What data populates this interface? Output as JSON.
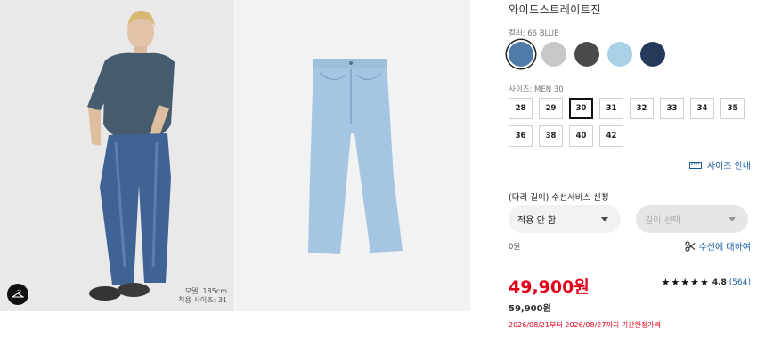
{
  "product": {
    "title": "와이드스트레이트진",
    "color_label": "컬러: 66 BLUE",
    "colors": [
      {
        "name": "blue",
        "hex": "#4e7ba8",
        "selected": true
      },
      {
        "name": "light-gray",
        "hex": "#c6c8c6"
      },
      {
        "name": "dark-gray",
        "hex": "#4a4a4a"
      },
      {
        "name": "light-blue",
        "hex": "#a9d1e6"
      },
      {
        "name": "navy",
        "hex": "#283a5c"
      }
    ],
    "size_label": "사이즈: MEN 30",
    "sizes": [
      "28",
      "29",
      "30",
      "31",
      "32",
      "33",
      "34",
      "35",
      "36",
      "38",
      "40",
      "42"
    ],
    "selected_size": "30",
    "size_guide": "사이즈 안내",
    "alteration": {
      "label": "(다리 길이) 수선서비스 신청",
      "option1": "적용 안 함",
      "option2": "길이 선택",
      "price": "0원",
      "about_link": "수선에 대하여"
    },
    "price": "49,900원",
    "original_price": "59,900원",
    "sale_period": "2026/08/21부터 2026/08/27까지 기간한정가격",
    "rating": {
      "stars": "★★★★★",
      "value": "4.8",
      "count": "(564)"
    }
  },
  "gallery": {
    "model_info_1": "모델: 185cm",
    "model_info_2": "착용 사이즈: 31"
  }
}
